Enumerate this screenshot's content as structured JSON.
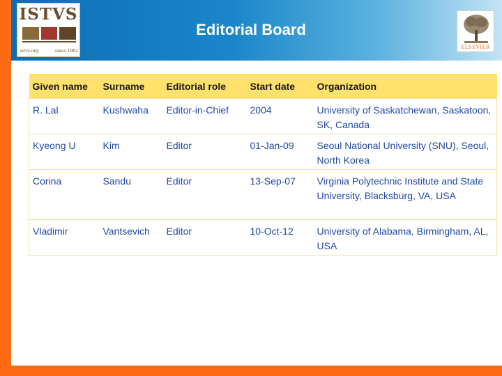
{
  "header": {
    "title": "Editorial Board",
    "logo": {
      "text": "ISTVS",
      "footer_left": "istvs.org",
      "footer_right": "since 1962"
    },
    "publisher_logo": {
      "text": "ELSEVIER"
    },
    "colors": {
      "accent": "#ff6a14",
      "header_blue": "#0c6db4",
      "table_header": "#ffe16b",
      "cell_text": "#1f49a8"
    }
  },
  "table": {
    "columns": [
      "Given name",
      "Surname",
      "Editorial role",
      "Start date",
      "Organization"
    ],
    "rows": [
      {
        "given": "R. Lal",
        "surname": "Kushwaha",
        "role": "Editor-in-Chief",
        "start": "2004",
        "org": "University of Saskatchewan, Saskatoon, SK, Canada"
      },
      {
        "given": "Kyeong U",
        "surname": "Kim",
        "role": "Editor",
        "start": "01-Jan-09",
        "org": "Seoul National University (SNU), Seoul, North Korea"
      },
      {
        "given": "Corina",
        "surname": "Sandu",
        "role": "Editor",
        "start": "13-Sep-07",
        "org": "Virginia Polytechnic Institute and State University, Blacksburg, VA, USA"
      },
      {
        "given": "Vladimir",
        "surname": "Vantsevich",
        "role": "Editor",
        "start": "10-Oct-12",
        "org": "University of Alabama, Birmingham, AL, USA"
      }
    ]
  }
}
